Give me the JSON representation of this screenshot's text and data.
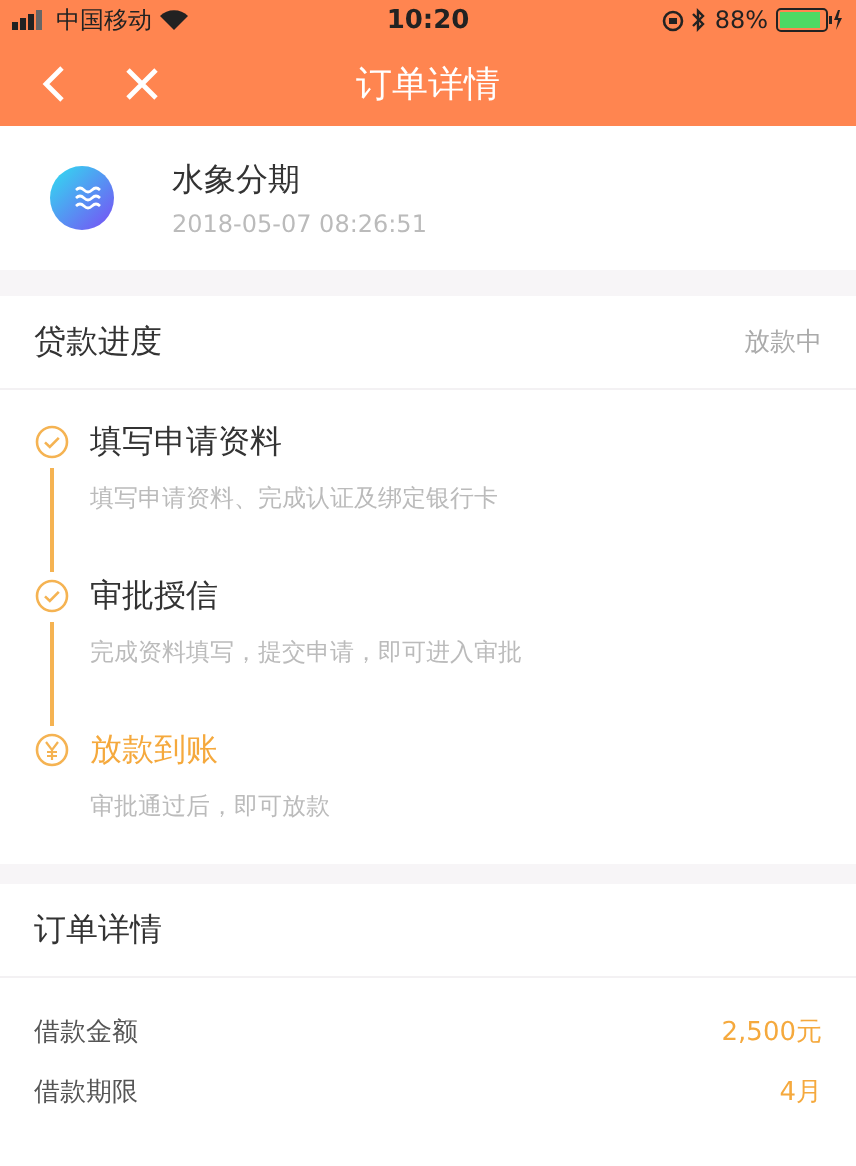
{
  "status_bar": {
    "carrier": "中国移动",
    "time": "10:20",
    "battery": "88%"
  },
  "nav": {
    "title": "订单详情"
  },
  "product": {
    "name": "水象分期",
    "date": "2018-05-07 08:26:51"
  },
  "progress": {
    "title": "贷款进度",
    "status": "放款中",
    "steps": [
      {
        "kind": "done",
        "title": "填写申请资料",
        "desc": "填写申请资料、完成认证及绑定银行卡"
      },
      {
        "kind": "done",
        "title": "审批授信",
        "desc": "完成资料填写，提交申请，即可进入审批"
      },
      {
        "kind": "current",
        "title": "放款到账",
        "desc": "审批通过后，即可放款"
      }
    ]
  },
  "details": {
    "title": "订单详情",
    "rows": [
      {
        "label": "借款金额",
        "value": "2,500元"
      },
      {
        "label": "借款期限",
        "value": "4月"
      }
    ]
  }
}
